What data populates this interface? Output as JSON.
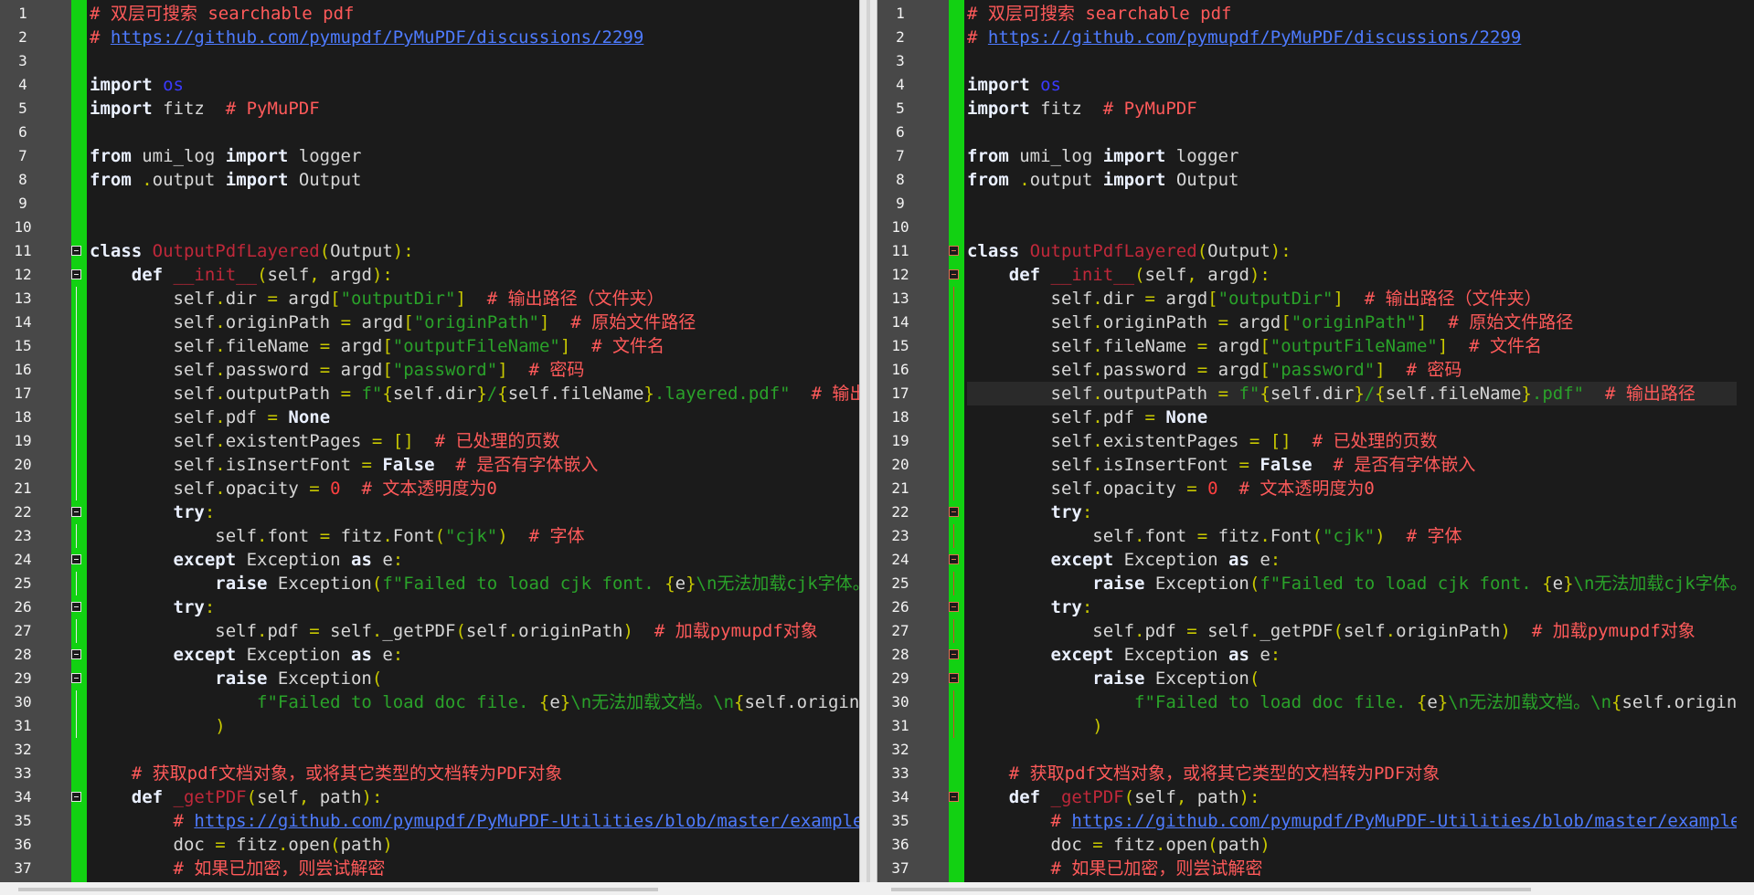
{
  "ui": {
    "line_count": 37
  },
  "lines": [
    {
      "n": "1",
      "c": "# 双层可搜索 searchable pdf"
    },
    {
      "n": "2",
      "c": "# https://github.com/pymupdf/PyMuPDF/discussions/2299"
    },
    {
      "n": "3",
      "c": ""
    },
    {
      "n": "4",
      "c": "import os"
    },
    {
      "n": "5",
      "c": "import fitz  # PyMuPDF"
    },
    {
      "n": "6",
      "c": ""
    },
    {
      "n": "7",
      "c": "from umi_log import logger"
    },
    {
      "n": "8",
      "c": "from .output import Output"
    },
    {
      "n": "9",
      "c": ""
    },
    {
      "n": "10",
      "c": ""
    },
    {
      "n": "11",
      "c": "class OutputPdfLayered(Output):"
    },
    {
      "n": "12",
      "c": "    def __init__(self, argd):"
    },
    {
      "n": "13",
      "c": "        self.dir = argd[\"outputDir\"]  # 输出路径（文件夹）"
    },
    {
      "n": "14",
      "c": "        self.originPath = argd[\"originPath\"]  # 原始文件路径"
    },
    {
      "n": "15",
      "c": "        self.fileName = argd[\"outputFileName\"]  # 文件名"
    },
    {
      "n": "16",
      "c": "        self.password = argd[\"password\"]  # 密码"
    },
    {
      "n": "17",
      "c": "        self.outputPath = f\"{self.dir}/{self.fileName}.layered.pdf\"  # 输出路径"
    },
    {
      "n": "18",
      "c": "        self.pdf = None"
    },
    {
      "n": "19",
      "c": "        self.existentPages = []  # 已处理的页数"
    },
    {
      "n": "20",
      "c": "        self.isInsertFont = False  # 是否有字体嵌入"
    },
    {
      "n": "21",
      "c": "        self.opacity = 0  # 文本透明度为0"
    },
    {
      "n": "22",
      "c": "        try:"
    },
    {
      "n": "23",
      "c": "            self.font = fitz.Font(\"cjk\")  # 字体"
    },
    {
      "n": "24",
      "c": "        except Exception as e:"
    },
    {
      "n": "25",
      "c": "            raise Exception(f\"Failed to load cjk font. {e}\\n无法加载cjk字体。\")"
    },
    {
      "n": "26",
      "c": "        try:"
    },
    {
      "n": "27",
      "c": "            self.pdf = self._getPDF(self.originPath)  # 加载pymupdf对象"
    },
    {
      "n": "28",
      "c": "        except Exception as e:"
    },
    {
      "n": "29",
      "c": "            raise Exception("
    },
    {
      "n": "30",
      "c": "                f\"Failed to load doc file. {e}\\n无法加载文档。\\n{self.originPath}\""
    },
    {
      "n": "31",
      "c": "            )"
    },
    {
      "n": "32",
      "c": ""
    },
    {
      "n": "33",
      "c": "    # 获取pdf文档对象，或将其它类型的文档转为PDF对象"
    },
    {
      "n": "34",
      "c": "    def _getPDF(self, path):"
    },
    {
      "n": "35",
      "c": "        # https://github.com/pymupdf/PyMuPDF-Utilities/blob/master/examples/convert-document"
    },
    {
      "n": "36",
      "c": "        doc = fitz.open(path)"
    },
    {
      "n": "37",
      "c": "        # 如果已加密，则尝试解密"
    }
  ],
  "right_line_17": "        self.outputPath = f\"{self.dir}/{self.fileName}.pdf\"  # 输出路径",
  "colors": {
    "diff_bar": "#12d112",
    "gutter": "#484848",
    "background": "#1b1b1b",
    "comment": "#ff5a5a",
    "string": "#2aa22a",
    "class_name": "#c0283a",
    "link": "#4e7bff"
  },
  "folds": [
    11,
    12,
    22,
    24,
    26,
    28,
    29,
    34
  ]
}
